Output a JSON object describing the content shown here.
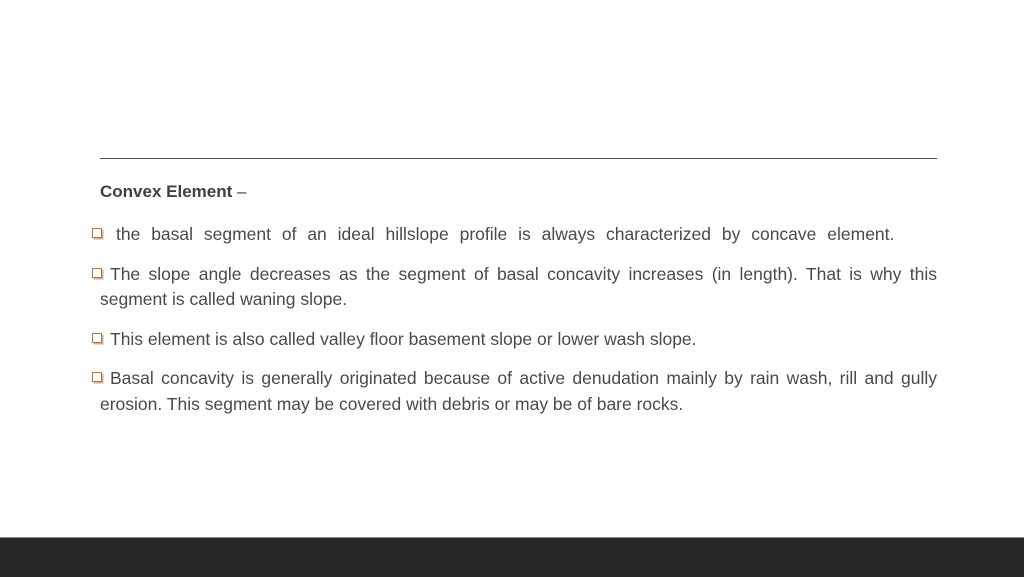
{
  "slide": {
    "heading": "Convex Element",
    "heading_suffix": "–",
    "bullets": [
      {
        "icon": "hollow-square-bullet",
        "text": "the basal segment of an ideal hillslope profile is always characterized by concave element."
      },
      {
        "icon": "hollow-square-bullet",
        "text": "The slope angle decreases as the segment of basal concavity increases (in length). That is why this segment is called waning slope."
      },
      {
        "icon": "hollow-square-bullet",
        "text": "This element is also called valley floor basement slope or lower wash slope."
      },
      {
        "icon": "hollow-square-bullet",
        "text": "Basal concavity is generally originated because of active denudation mainly by rain wash, rill and gully erosion. This segment may be covered with debris or may be of bare rocks."
      }
    ],
    "colors": {
      "bullet": "#b0784a",
      "footer": "#262626",
      "text": "#4a4a4a"
    }
  }
}
